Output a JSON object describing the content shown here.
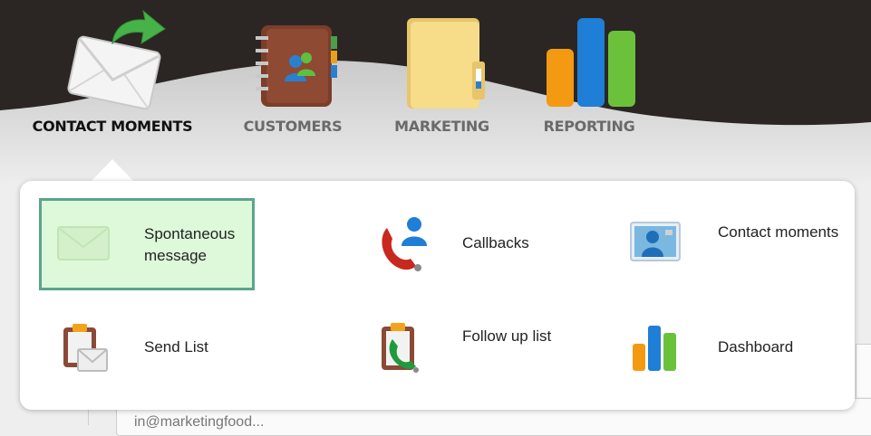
{
  "nav": {
    "items": [
      {
        "label": "CONTACT MOMENTS",
        "icon": "envelope-arrow-icon",
        "active": true
      },
      {
        "label": "CUSTOMERS",
        "icon": "address-book-icon",
        "active": false
      },
      {
        "label": "MARKETING",
        "icon": "folder-icon",
        "active": false
      },
      {
        "label": "REPORTING",
        "icon": "bar-chart-icon",
        "active": false
      }
    ]
  },
  "dropdown": {
    "items": [
      {
        "label": "Spontaneous message",
        "icon": "envelope-icon",
        "selected": true
      },
      {
        "label": "Callbacks",
        "icon": "phone-person-icon",
        "selected": false
      },
      {
        "label": "Contact moments",
        "icon": "contact-card-icon",
        "selected": false
      },
      {
        "label": "Send List",
        "icon": "clipboard-envelope-icon",
        "selected": false
      },
      {
        "label": "Follow up list",
        "icon": "clipboard-phone-icon",
        "selected": false
      },
      {
        "label": "Dashboard",
        "icon": "bar-chart-icon",
        "selected": false
      }
    ]
  },
  "background": {
    "field_text": "in@marketingfood..."
  },
  "colors": {
    "header_dark": "#2b2624",
    "header_grey": "#b9b9b9",
    "selected_bg": "#ddf9d9",
    "selected_border": "#5aa58c"
  }
}
